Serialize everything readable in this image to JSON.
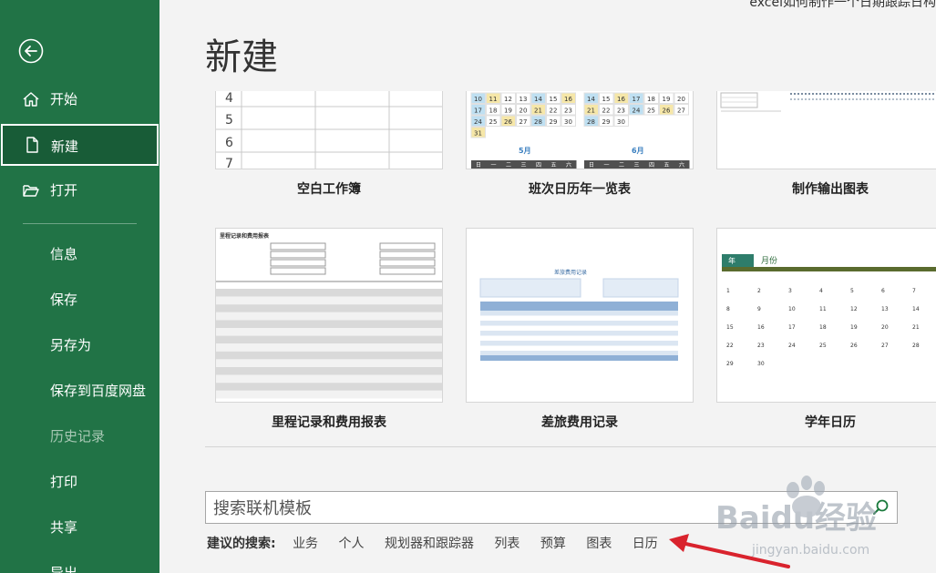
{
  "window": {
    "top_right_text": "excel如何制作一个日期跟踪日构"
  },
  "sidebar": {
    "items": [
      {
        "label": "开始",
        "name": "home"
      },
      {
        "label": "新建",
        "name": "new"
      },
      {
        "label": "打开",
        "name": "open"
      },
      {
        "label": "信息",
        "name": "info"
      },
      {
        "label": "保存",
        "name": "save"
      },
      {
        "label": "另存为",
        "name": "save-as"
      },
      {
        "label": "保存到百度网盘",
        "name": "save-to-baidu"
      },
      {
        "label": "历史记录",
        "name": "history"
      },
      {
        "label": "打印",
        "name": "print"
      },
      {
        "label": "共享",
        "name": "share"
      },
      {
        "label": "导出",
        "name": "export"
      }
    ]
  },
  "main": {
    "title": "新建",
    "templates": [
      {
        "name": "空白工作簿",
        "row_numbers": [
          "4",
          "5",
          "6",
          "7"
        ]
      },
      {
        "name": "班次日历年一览表",
        "months": [
          "5月",
          "6月"
        ],
        "may_rows": [
          [
            "10",
            "11",
            "12",
            "13",
            "14",
            "15",
            "16"
          ],
          [
            "17",
            "18",
            "19",
            "20",
            "21",
            "22",
            "23"
          ],
          [
            "24",
            "25",
            "26",
            "27",
            "28",
            "29",
            "30"
          ],
          [
            "31",
            "",
            "",
            "",
            "",
            "",
            ""
          ]
        ],
        "jun_rows": [
          [
            "14",
            "15",
            "16",
            "17",
            "18",
            "19",
            "20"
          ],
          [
            "21",
            "22",
            "23",
            "24",
            "25",
            "26",
            "27"
          ],
          [
            "28",
            "29",
            "30",
            "",
            "",
            "",
            ""
          ]
        ],
        "weekdays": [
          "日",
          "一",
          "二",
          "三",
          "四",
          "五",
          "六"
        ]
      },
      {
        "name": "制作输出图表"
      },
      {
        "name": "里程记录和费用报表",
        "heading": "里程记录和费用报表"
      },
      {
        "name": "差旅费用记录",
        "heading": "差旅费用记录"
      },
      {
        "name": "学年日历",
        "year_label": "年",
        "month_label": "月份",
        "cal_rows": [
          [
            "1",
            "2",
            "3",
            "4",
            "5",
            "6",
            "7"
          ],
          [
            "8",
            "9",
            "10",
            "11",
            "12",
            "13",
            "14"
          ],
          [
            "15",
            "16",
            "17",
            "18",
            "19",
            "20",
            "21"
          ],
          [
            "22",
            "23",
            "24",
            "25",
            "26",
            "27",
            "28"
          ],
          [
            "29",
            "30",
            "",
            "",
            "",
            "",
            ""
          ]
        ]
      }
    ],
    "search": {
      "placeholder": "搜索联机模板",
      "value": ""
    },
    "suggestions": {
      "label": "建议的搜索:",
      "items": [
        "业务",
        "个人",
        "规划器和跟踪器",
        "列表",
        "预算",
        "图表",
        "日历"
      ]
    }
  },
  "watermark": {
    "text": "Baidu经验",
    "url_text": "jingyan.baidu.com"
  },
  "colors": {
    "sidebar": "#217346",
    "sidebar_selected": "#185c37",
    "accent_arrow": "#d9232d"
  }
}
